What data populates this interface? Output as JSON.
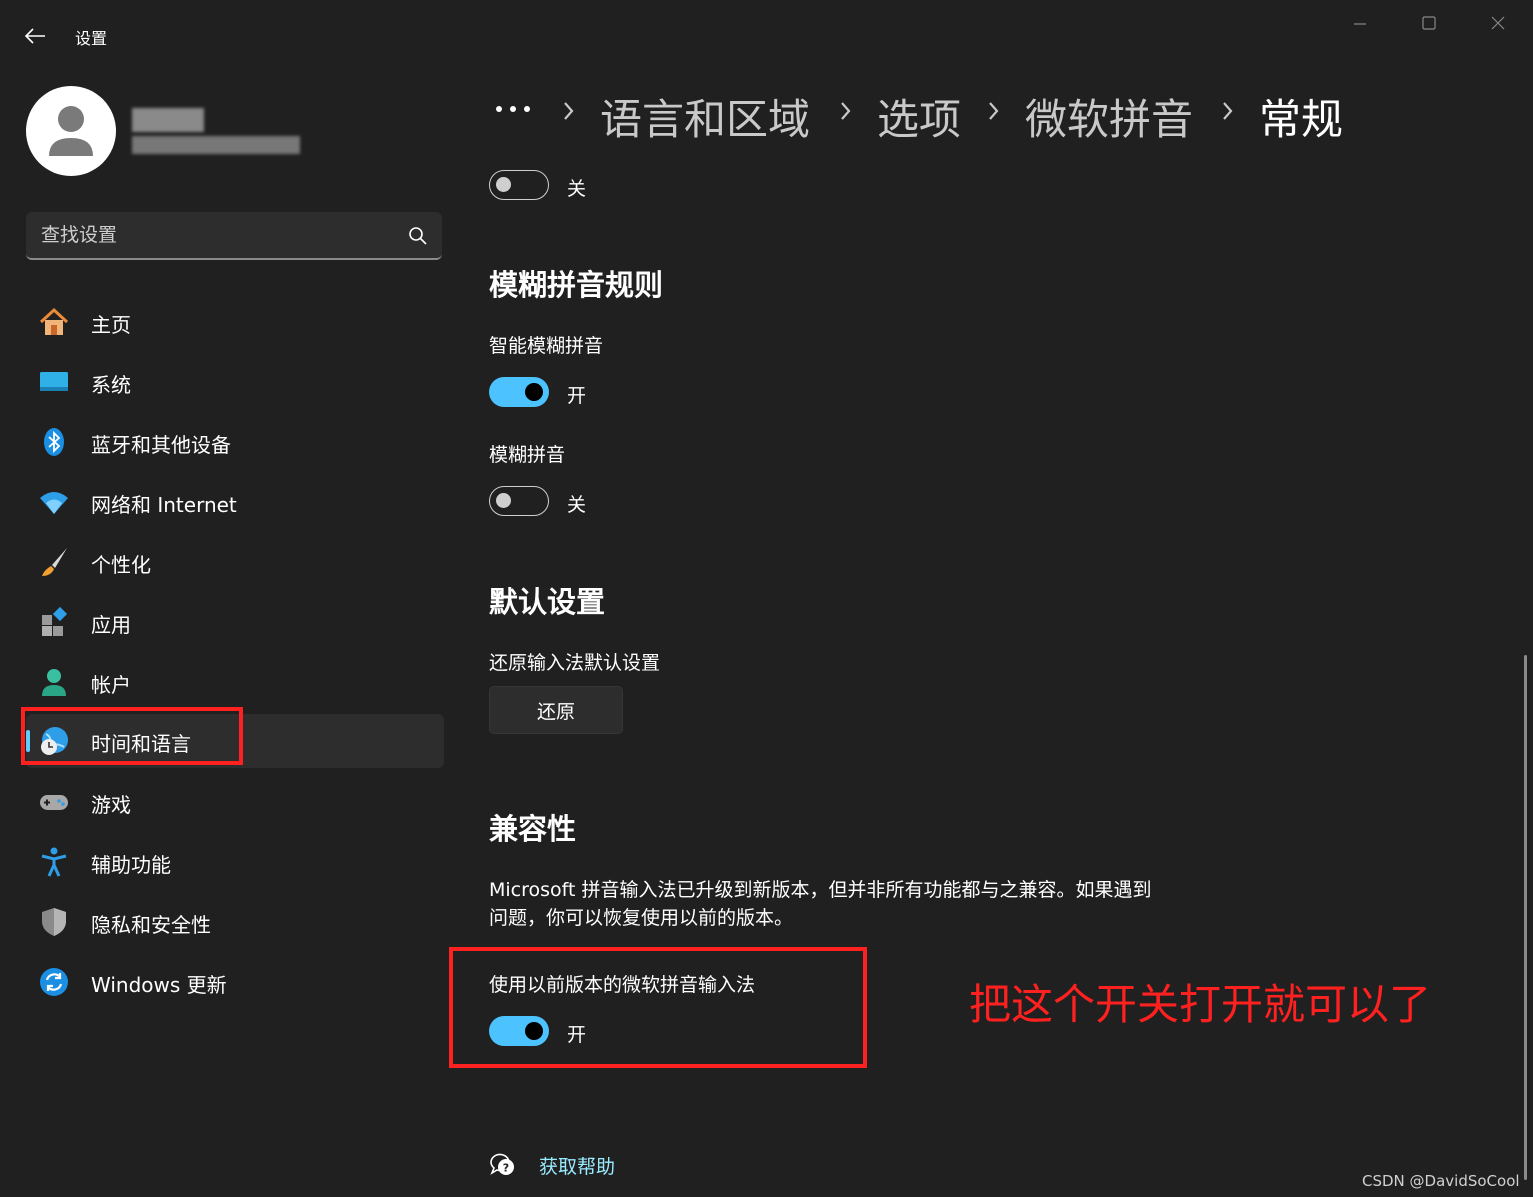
{
  "window": {
    "title": "设置"
  },
  "sidebar": {
    "search": {
      "placeholder": "查找设置"
    },
    "items": [
      {
        "label": "主页"
      },
      {
        "label": "系统"
      },
      {
        "label": "蓝牙和其他设备"
      },
      {
        "label": "网络和 Internet"
      },
      {
        "label": "个性化"
      },
      {
        "label": "应用"
      },
      {
        "label": "帐户"
      },
      {
        "label": "时间和语言",
        "selected": true
      },
      {
        "label": "游戏"
      },
      {
        "label": "辅助功能"
      },
      {
        "label": "隐私和安全性"
      },
      {
        "label": "Windows 更新"
      }
    ]
  },
  "breadcrumb": {
    "overflow": "•••",
    "items": [
      "语言和区域",
      "选项",
      "微软拼音",
      "常规"
    ]
  },
  "content": {
    "top_toggle": {
      "state_label": "关",
      "on": false
    },
    "fuzzy": {
      "heading": "模糊拼音规则",
      "smart_label": "智能模糊拼音",
      "smart_toggle": {
        "state_label": "开",
        "on": true
      },
      "fuzzy_label": "模糊拼音",
      "fuzzy_toggle": {
        "state_label": "关",
        "on": false
      }
    },
    "defaults": {
      "heading": "默认设置",
      "restore_label": "还原输入法默认设置",
      "restore_button": "还原"
    },
    "compat": {
      "heading": "兼容性",
      "description": "Microsoft 拼音输入法已升级到新版本，但并非所有功能都与之兼容。如果遇到问题，你可以恢复使用以前的版本。",
      "legacy_label": "使用以前版本的微软拼音输入法",
      "legacy_toggle": {
        "state_label": "开",
        "on": true
      }
    },
    "help_link": "获取帮助"
  },
  "annotation": {
    "text": "把这个开关打开就可以了",
    "color": "#ff2020"
  },
  "watermark": "CSDN @DavidSoCool",
  "colors": {
    "accent": "#4cc2ff",
    "background": "#202020",
    "link": "#99ebff"
  }
}
